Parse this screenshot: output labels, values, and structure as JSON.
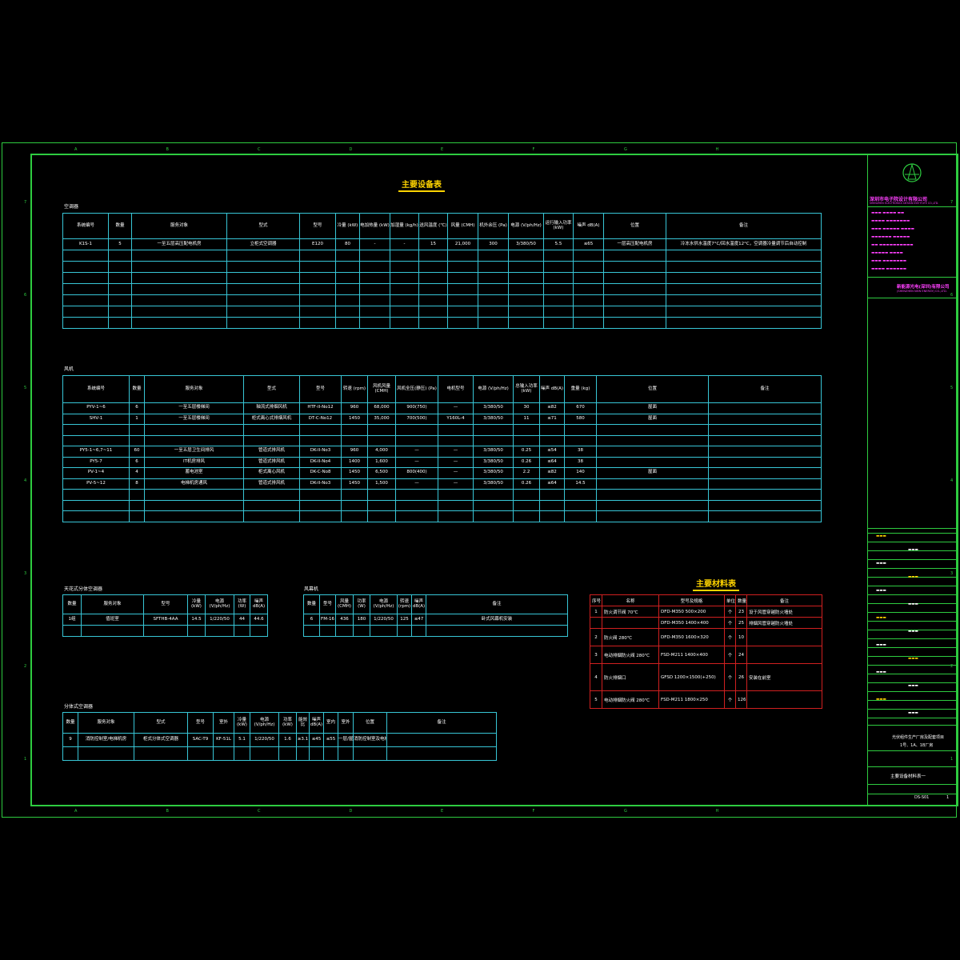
{
  "drawing_title": "主要设备表",
  "materials_title": "主要材料表",
  "ruler": {
    "columns": [
      "A",
      "B",
      "C",
      "D",
      "E",
      "F",
      "G",
      "H"
    ],
    "rows": [
      "7",
      "6",
      "5",
      "4",
      "3",
      "2",
      "1"
    ]
  },
  "chiller": {
    "section_label": "空调器",
    "headers": [
      "系统编号",
      "数量",
      "服务对象",
      "型式",
      "型号",
      "冷量 (kW)",
      "电加热量 (kW)",
      "加湿量 (kg/h)",
      "送风温度 (℃)",
      "风量 (CMH)",
      "机外余压 (Pa)",
      "电源 (V/ph/Hz)",
      "运行输入功率 (kW)",
      "噪声 dB(A)",
      "位置",
      "备注"
    ],
    "rows": [
      [
        "K1S-1",
        "5",
        "一至五层高压配电机房",
        "立柜式空调器",
        "E120",
        "80",
        "-",
        "-",
        "15",
        "21,000",
        "300",
        "3/380/50",
        "5.5",
        "≤65",
        "一层高压配电机房",
        "冷冻水供水温度7°C/回水温度12°C，空调器冷量调节后自动控制"
      ]
    ]
  },
  "fans": {
    "section_label": "风机",
    "headers": [
      "系统编号",
      "数量",
      "服务对象",
      "型式",
      "型号",
      "转速 (rpm)",
      "风机风量 (CMH)",
      "风机全压(静压) (Pa)",
      "电机型号",
      "电源 (V/ph/Hz)",
      "总输入功率 (kW)",
      "噪声 dB(A)",
      "重量 (kg)",
      "位置",
      "备注"
    ],
    "rows": [
      [
        "PYV-1~6",
        "6",
        "一至五层楼梯间",
        "轴流式排烟风机",
        "HTF-II-No12",
        "960",
        "68,000",
        "900(750)",
        "—",
        "3/380/50",
        "30",
        "≤82",
        "670",
        "屋面",
        ""
      ],
      [
        "SHV-1",
        "1",
        "一至五层楼梯间",
        "柜式离心式排烟风机",
        "DT-C-No12",
        "1450",
        "35,000",
        "700(500)",
        "Y160L-4",
        "3/380/50",
        "11",
        "≤71",
        "580",
        "屋面",
        ""
      ],
      [
        "",
        "",
        "",
        "",
        "",
        "",
        "",
        "",
        "",
        "",
        "",
        "",
        "",
        "",
        ""
      ],
      [
        "",
        "",
        "",
        "",
        "",
        "",
        "",
        "",
        "",
        "",
        "",
        "",
        "",
        "",
        ""
      ],
      [
        "PY5-1~6,7~11",
        "60",
        "一至五层卫生间排风",
        "管道式排风机",
        "DK-II-No3",
        "960",
        "4,000",
        "—",
        "—",
        "3/380/50",
        "0.25",
        "≤54",
        "38",
        "",
        ""
      ],
      [
        "PY5-7",
        "6",
        "IT机房排风",
        "管道式排风机",
        "DK-II-No4",
        "1400",
        "1,600",
        "—",
        "—",
        "3/380/50",
        "0.26",
        "≤64",
        "38",
        "",
        ""
      ],
      [
        "PV-1~4",
        "4",
        "蓄电池室",
        "柜式离心风机",
        "DK-C-No8",
        "1450",
        "6,500",
        "800(400)",
        "—",
        "3/380/50",
        "2.2",
        "≤82",
        "140",
        "屋面",
        ""
      ],
      [
        "PV-5~12",
        "8",
        "电梯机房通风",
        "管道式排风机",
        "DK-II-No3",
        "1450",
        "1,500",
        "—",
        "—",
        "3/380/50",
        "0.26",
        "≤64",
        "14.5",
        "",
        ""
      ],
      [
        "",
        "",
        "",
        "",
        "",
        "",
        "",
        "",
        "",
        "",
        "",
        "",
        "",
        "",
        ""
      ],
      [
        "",
        "",
        "",
        "",
        "",
        "",
        "",
        "",
        "",
        "",
        "",
        "",
        "",
        "",
        ""
      ],
      [
        "",
        "",
        "",
        "",
        "",
        "",
        "",
        "",
        "",
        "",
        "",
        "",
        "",
        "",
        ""
      ]
    ]
  },
  "ceiling_ac": {
    "section_label": "天花式分体空调器",
    "headers": [
      "数量",
      "服务对象",
      "型号",
      "冷量 (kW)",
      "电源 (V/ph/Hz)",
      "功率 (W)",
      "噪声 dB(A)"
    ],
    "rows": [
      [
        "1组",
        "值班室",
        "SFTHB-4AA",
        "14.5",
        "1/220/50",
        "44",
        "44.6"
      ]
    ]
  },
  "curtain": {
    "section_label": "风幕机",
    "headers": [
      "数量",
      "型号",
      "风量 (CMH)",
      "功率 (W)",
      "电源 (V/ph/Hz)",
      "转速 (rpm)",
      "噪声 dB(A)",
      "备注"
    ],
    "rows": [
      [
        "6",
        "FM-16",
        "436",
        "180",
        "1/220/50",
        "125",
        "≤47",
        "卧式风幕机安装"
      ]
    ]
  },
  "split_ac": {
    "section_label": "分体式空调器",
    "headers": [
      "数量",
      "服务对象",
      "型式",
      "型号",
      "室外",
      "冷量 (kW)",
      "电源 (V/ph/Hz)",
      "功率 (kW)",
      "能效比",
      "噪声 dB(A)",
      "室内",
      "室外",
      "位置",
      "备注"
    ],
    "rows": [
      [
        "9",
        "消防控制室/电梯机房",
        "柜式分体式空调器",
        "SAC-T9",
        "KF-51L",
        "5.1",
        "1/220/50",
        "1.6",
        "≥3.1",
        "≤45",
        "≤55",
        "一层/屋面",
        "消防控制室及电梯机房设置"
      ]
    ]
  },
  "materials": {
    "headers": [
      "序号",
      "名称",
      "型号及规格",
      "单位",
      "数量",
      "备注"
    ],
    "rows": [
      [
        "1",
        "防火调节阀 70℃",
        "DFD-M350  500×200",
        "个",
        "23",
        "设于风管穿越防火墙处"
      ],
      [
        "",
        "",
        "DFD-M350  1400×400",
        "个",
        "25",
        "排烟风管穿越防火墙处"
      ],
      [
        "2",
        "防火阀 280℃",
        "DFD-M350  1600×320",
        "个",
        "10",
        ""
      ],
      [
        "3",
        "电动排烟防火阀 280℃",
        "FSD-M211  1400×400",
        "个",
        "24",
        ""
      ],
      [
        "4",
        "防火排烟口",
        "GFSD    1200×1500(+250)",
        "个",
        "26",
        "安装在前室"
      ],
      [
        "5",
        "电动排烟防火阀 280℃",
        "FSD-M211  1800×250",
        "个",
        "126",
        ""
      ]
    ]
  },
  "title_block": {
    "company": "深圳市电子院设计有限公司",
    "company_en": "SHENZHEN ELECTRONICS DESIGN INSTITUTE CO.,LTD.",
    "client": "新能源光电(深圳)有限公司",
    "client_en": "(SHENZHEN NEW ENERGY) CO.,LTD.",
    "project": "光伏组件生产厂房及配套项目",
    "project_sub": "1号、1A、1B厂房",
    "sheet_name": "主要设备材料表一",
    "drawing_no": "DS-S01",
    "sheet_no": "1"
  }
}
